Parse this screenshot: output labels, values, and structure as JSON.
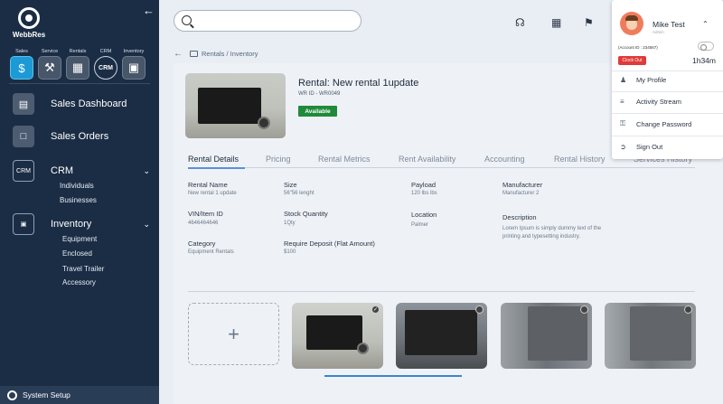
{
  "brand": {
    "name": "WebbRes"
  },
  "modules": [
    {
      "label": "Sales",
      "icon": "$",
      "icon_name": "dollar-icon",
      "active": true
    },
    {
      "label": "Service",
      "icon": "⚒",
      "icon_name": "wrench-icon",
      "active": false
    },
    {
      "label": "Rentals",
      "icon": "▦",
      "icon_name": "calendar-icon",
      "active": false
    },
    {
      "label": "CRM",
      "icon": "CRM",
      "icon_name": "crm-icon",
      "active": false
    },
    {
      "label": "Inventory",
      "icon": "▣",
      "icon_name": "inventory-icon",
      "active": false
    }
  ],
  "nav": {
    "sales_dashboard": "Sales Dashboard",
    "sales_orders": "Sales Orders",
    "crm": {
      "label": "CRM",
      "items": [
        "Individuals",
        "Businesses"
      ]
    },
    "inventory": {
      "label": "Inventory",
      "items": [
        "Equipment",
        "Enclosed",
        "Travel Trailer",
        "Accessory"
      ]
    },
    "system_setup": "System Setup"
  },
  "breadcrumb": "Rentals / Inventory",
  "rental": {
    "title": "Rental: New rental 1update",
    "wr_id": "WR ID - WR0049",
    "status": "Available"
  },
  "tabs": [
    "Rental Details",
    "Pricing",
    "Rental Metrics",
    "Rent Availability",
    "Accounting",
    "Rental History",
    "Services History"
  ],
  "details": {
    "rental_name": {
      "label": "Rental Name",
      "value": "New rental 1 update"
    },
    "size": {
      "label": "Size",
      "value": "56\"56 lenght"
    },
    "payload": {
      "label": "Payload",
      "value": "120  lbs  lbs"
    },
    "manufacturer": {
      "label": "Manufacturer",
      "value": "Manufacturer 2"
    },
    "vin": {
      "label": "VIN/Item ID",
      "value": "4646464646"
    },
    "stock_qty": {
      "label": "Stock Quantity",
      "value": "1Qty"
    },
    "location": {
      "label": "Location",
      "value": "Palmer"
    },
    "description": {
      "label": "Description",
      "value_line1": "Lorem Ipsum is simply dummy text of the",
      "value_line2": "printing and typesetting industry."
    },
    "category": {
      "label": "Category",
      "value": "Equipment Rentals"
    },
    "deposit": {
      "label": "Require Deposit (Flat Amount)",
      "value": "$100"
    }
  },
  "gallery": {
    "add_symbol": "+",
    "check_symbol": "✓"
  },
  "profile": {
    "name": "Mike Test",
    "role": "Admin",
    "account_id": "(Account ID : 234567)",
    "clock_out": "Clock Out",
    "hours": "1h34m",
    "menu": [
      "My Profile",
      "Activity Stream",
      "Change Password",
      "Sign Out"
    ]
  },
  "colors": {
    "sidebar": "#1b2d45",
    "accent": "#1b9ad6",
    "available": "#1f8b3a",
    "clock_out": "#e03a3a"
  }
}
